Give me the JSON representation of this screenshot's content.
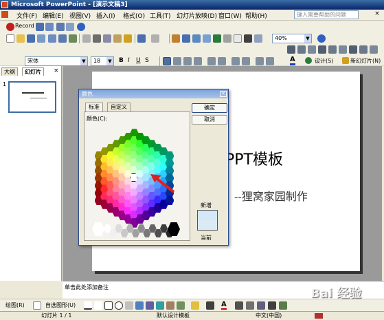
{
  "titlebar": {
    "title": "Microsoft PowerPoint - [演示文稿3]"
  },
  "menu": {
    "items": [
      "文件(F)",
      "编辑(E)",
      "视图(V)",
      "插入(I)",
      "格式(O)",
      "工具(T)",
      "幻灯片放映(D)",
      "窗口(W)",
      "帮助(H)"
    ],
    "ask_placeholder": "键入需要帮助的问题",
    "close_glyph": "×"
  },
  "toolbar1": {
    "record_label": "Record"
  },
  "toolbar2": {
    "zoom": "40%"
  },
  "toolbar3": {
    "font": "宋体",
    "size": "18",
    "design_label": "设计(S)",
    "new_slide_label": "新幻灯片(N)"
  },
  "panel": {
    "tabs": [
      "大纲",
      "幻灯片"
    ],
    "slide_number": "1",
    "close_glyph": "×"
  },
  "slide": {
    "title": "PPT模板",
    "subtitle": "--狸窝家园制作"
  },
  "notes": {
    "placeholder": "单击此处添加备注"
  },
  "drawbar": {
    "draw_label": "绘图(R)",
    "autoshape_label": "自选图形(U)"
  },
  "status": {
    "slide_info": "幻灯片 1 / 1",
    "template": "默认设计模板",
    "language": "中文(中国)"
  },
  "dialog": {
    "title": "颜色",
    "tabs": [
      "标准",
      "自定义"
    ],
    "colors_label": "颜色(C):",
    "ok": "确定",
    "cancel": "取消",
    "new_label": "新增",
    "current_label": "当前",
    "new_color": "#d4e8f8",
    "current_color": "#dbe9f4"
  },
  "watermark": "Bai 经验"
}
